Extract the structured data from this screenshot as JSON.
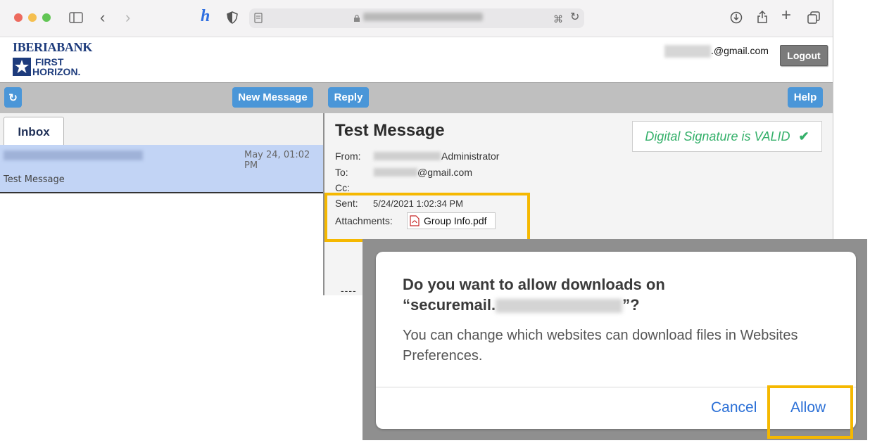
{
  "account": {
    "email_suffix": ".@gmail.com",
    "logout_label": "Logout"
  },
  "brand": {
    "top": "IBERIABANK",
    "line1": "FIRST",
    "line2": "HORIZON."
  },
  "actions": {
    "refresh_icon": "↻",
    "new_message": "New Message",
    "reply": "Reply",
    "help": "Help"
  },
  "inbox": {
    "tab_label": "Inbox",
    "items": [
      {
        "date": "May 24, 01:02 PM",
        "subject": "Test Message"
      }
    ]
  },
  "message": {
    "subject": "Test Message",
    "from_label": "From:",
    "from_suffix": "Administrator",
    "to_label": "To:",
    "to_suffix": "@gmail.com",
    "cc_label": "Cc:",
    "sent_label": "Sent:",
    "sent_value": "5/24/2021 1:02:34 PM",
    "attachments_label": "Attachments:",
    "attachment_name": "Group Info.pdf",
    "signature_text": "Digital Signature is VALID",
    "body_dashes": "----"
  },
  "dialog": {
    "title_line1": "Do you want to allow downloads on",
    "title_prefix": "“securemail.",
    "title_suffix": "”?",
    "body": "You can change which websites can download files in Websites Preferences.",
    "cancel_label": "Cancel",
    "allow_label": "Allow"
  },
  "colors": {
    "accent_blue": "#4a96d8",
    "highlight": "#f5b800",
    "valid_green": "#34b06a",
    "selected_row": "#c2d4f5"
  }
}
